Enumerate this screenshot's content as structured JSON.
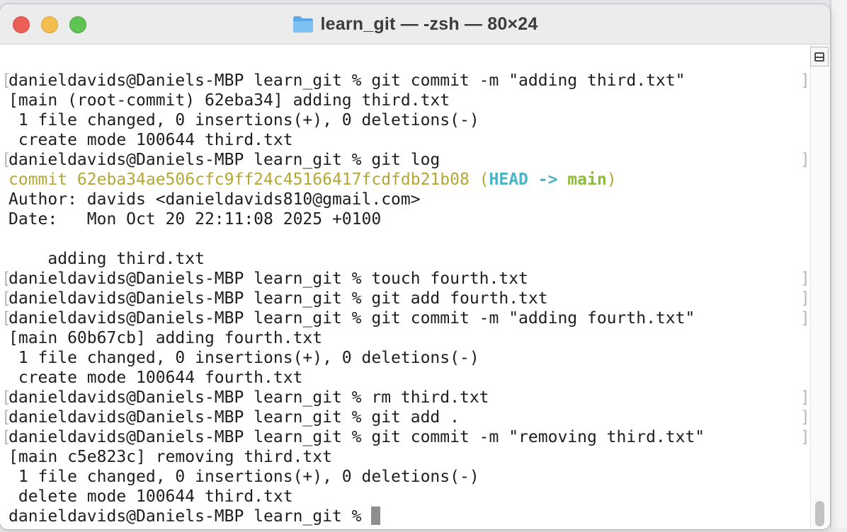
{
  "window": {
    "title": "learn_git — -zsh — 80×24",
    "folder_icon": "folder-icon",
    "controls": [
      "close",
      "minimize",
      "zoom"
    ]
  },
  "terminal": {
    "lines": [
      {
        "text": "danieldavids@Daniels-MBP learn_git % git commit -m \"adding third.txt\"",
        "marked": true
      },
      {
        "text": "[main (root-commit) 62eba34] adding third.txt",
        "marked": false
      },
      {
        "text": " 1 file changed, 0 insertions(+), 0 deletions(-)",
        "marked": false
      },
      {
        "text": " create mode 100644 third.txt",
        "marked": false
      },
      {
        "text": "danieldavids@Daniels-MBP learn_git % git log",
        "marked": true
      },
      {
        "text": "",
        "marked": false
      },
      {
        "text": "Author: davids <danieldavids810@gmail.com>",
        "marked": false
      },
      {
        "text": "Date:   Mon Oct 20 22:11:08 2025 +0100",
        "marked": false
      },
      {
        "text": "",
        "marked": false
      },
      {
        "text": "    adding third.txt",
        "marked": false
      },
      {
        "text": "danieldavids@Daniels-MBP learn_git % touch fourth.txt",
        "marked": true
      },
      {
        "text": "danieldavids@Daniels-MBP learn_git % git add fourth.txt",
        "marked": true
      },
      {
        "text": "danieldavids@Daniels-MBP learn_git % git commit -m \"adding fourth.txt\"",
        "marked": true
      },
      {
        "text": "[main 60b67cb] adding fourth.txt",
        "marked": false
      },
      {
        "text": " 1 file changed, 0 insertions(+), 0 deletions(-)",
        "marked": false
      },
      {
        "text": " create mode 100644 fourth.txt",
        "marked": false
      },
      {
        "text": "danieldavids@Daniels-MBP learn_git % rm third.txt",
        "marked": true
      },
      {
        "text": "danieldavids@Daniels-MBP learn_git % git add .",
        "marked": true
      },
      {
        "text": "danieldavids@Daniels-MBP learn_git % git commit -m \"removing third.txt\"",
        "marked": true
      },
      {
        "text": "[main c5e823c] removing third.txt",
        "marked": false
      },
      {
        "text": " 1 file changed, 0 insertions(+), 0 deletions(-)",
        "marked": false
      },
      {
        "text": " delete mode 100644 third.txt",
        "marked": false
      }
    ],
    "commit_line": {
      "prefix": "commit 62eba34ae506cfc9ff24c45166417fcdfdb21b08 (",
      "head": "HEAD -> ",
      "branch": "main",
      "suffix": ")"
    },
    "prompt": "danieldavids@Daniels-MBP learn_git % "
  },
  "colors": {
    "commit_hash": "#b5a733",
    "head_ref": "#4cb3c7",
    "branch_ref": "#8bbd3a"
  }
}
